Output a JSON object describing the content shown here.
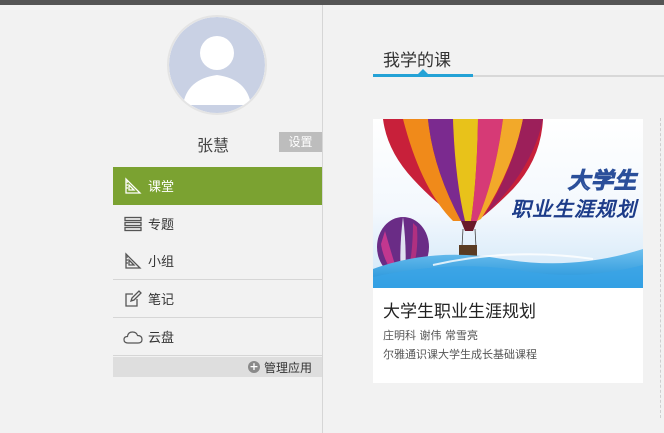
{
  "user": {
    "name": "张慧",
    "settings_label": "设置"
  },
  "nav": {
    "items": [
      {
        "label": "课堂",
        "icon": "classroom-icon",
        "active": true
      },
      {
        "label": "专题",
        "icon": "topic-icon",
        "active": false
      },
      {
        "label": "小组",
        "icon": "group-icon",
        "active": false
      },
      {
        "label": "笔记",
        "icon": "note-icon",
        "active": false
      },
      {
        "label": "云盘",
        "icon": "cloud-icon",
        "active": false
      }
    ],
    "manage_label": "管理应用"
  },
  "main": {
    "tab_title": "我学的课"
  },
  "course": {
    "cover_line1": "大学生",
    "cover_line2": "职业生涯规划",
    "name": "大学生职业生涯规划",
    "teachers": "庄明科 谢伟 常雪亮",
    "description": "尔雅通识课大学生成长基础课程"
  },
  "colors": {
    "accent_green": "#7ba231",
    "tab_blue": "#24a2d6"
  }
}
